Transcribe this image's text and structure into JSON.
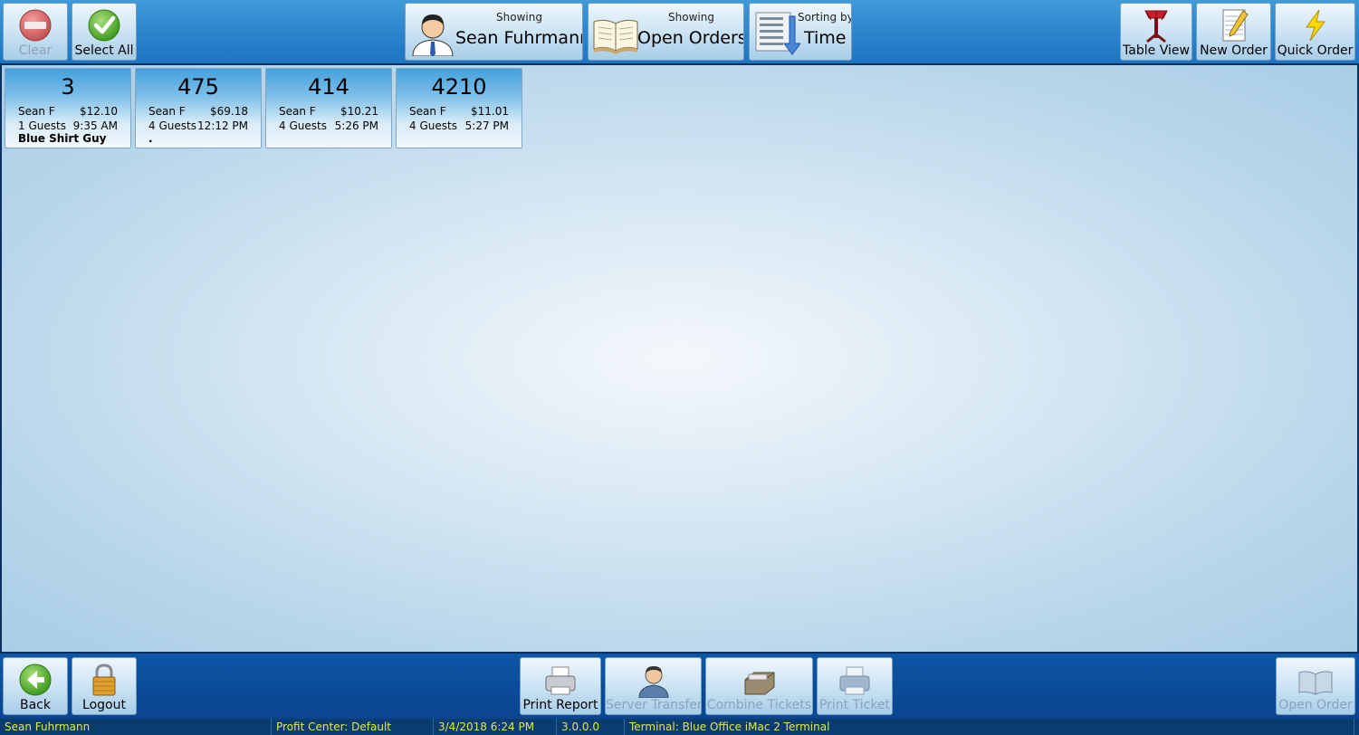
{
  "toolbar": {
    "clear_label": "Clear",
    "select_all_label": "Select All",
    "server_filter": {
      "caption": "Showing",
      "value": "Sean Fuhrmann"
    },
    "order_filter": {
      "caption": "Showing",
      "value": "Open Orders"
    },
    "sort": {
      "caption": "Sorting by",
      "value": "Time"
    },
    "table_view_label": "Table View",
    "new_order_label": "New Order",
    "quick_order_label": "Quick Order"
  },
  "tickets": [
    {
      "number": "3",
      "server": "Sean F",
      "total": "$12.10",
      "guests": "1 Guests",
      "time": "9:35 AM",
      "note": "Blue Shirt Guy"
    },
    {
      "number": "475",
      "server": "Sean F",
      "total": "$69.18",
      "guests": "4 Guests",
      "time": "12:12 PM",
      "note": "."
    },
    {
      "number": "414",
      "server": "Sean F",
      "total": "$10.21",
      "guests": "4 Guests",
      "time": "5:26 PM",
      "note": ""
    },
    {
      "number": "4210",
      "server": "Sean F",
      "total": "$11.01",
      "guests": "4 Guests",
      "time": "5:27 PM",
      "note": ""
    }
  ],
  "bottom": {
    "back_label": "Back",
    "logout_label": "Logout",
    "print_report_label": "Print Report",
    "server_transfer_label": "Server Transfer",
    "combine_tickets_label": "Combine Tickets",
    "print_ticket_label": "Print Ticket",
    "open_order_label": "Open Order"
  },
  "status": {
    "user": "Sean Fuhrmann",
    "profit_center": "Profit Center: Default",
    "datetime": "3/4/2018 6:24 PM",
    "version": "3.0.0.0",
    "terminal": "Terminal: Blue Office iMac 2 Terminal"
  },
  "colors": {
    "status_text": "#e6e64a",
    "disabled_text": "#8aa3b8"
  }
}
